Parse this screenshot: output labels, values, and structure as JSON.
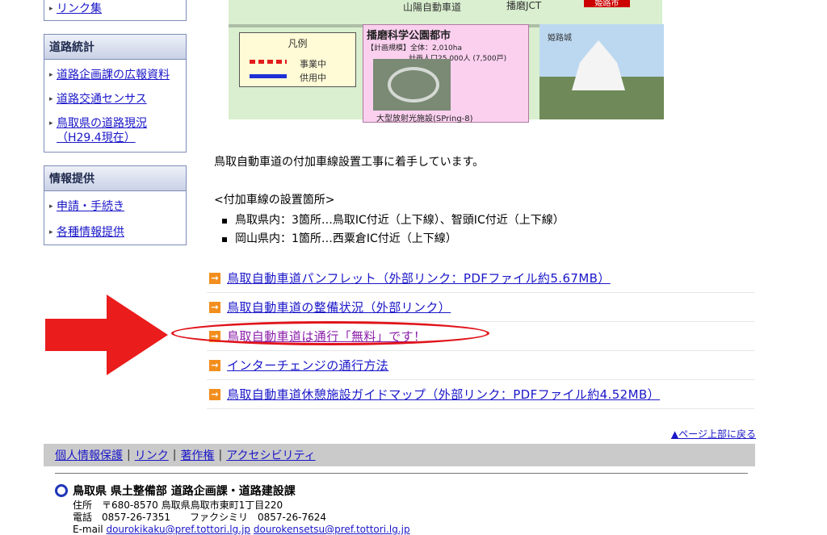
{
  "sidebar": {
    "top_item": "リンク集",
    "boxes": [
      {
        "title": "道路統計",
        "items": [
          "道路企画課の広報資料",
          "道路交通センサス",
          "鳥取県の道路現況",
          "（H29.4現在）"
        ]
      },
      {
        "title": "情報提供",
        "items": [
          "申請・手続き",
          "各種情報提供"
        ]
      }
    ]
  },
  "map": {
    "road_label": "山陽自動車道",
    "jct_label": "播磨JCT",
    "himeji_tag": "姫路市",
    "legend": {
      "title": "凡例",
      "under_construction": "事業中",
      "in_service": "供用中"
    },
    "science_city": {
      "title": "播磨科学公園都市",
      "line1": "【計画規模】全体：2,010ha",
      "line2": "計画人口25,000人 (7,500戸)",
      "caption": "大型放射光施設(SPring-8)"
    },
    "castle_label": "姫路城"
  },
  "intro_text": "鳥取自動車道の付加車線設置工事に着手しています。",
  "sub_title": "<付加車線の設置箇所>",
  "bullets": [
    "鳥取県内：3箇所…鳥取IC付近（上下線）、智頭IC付近（上下線）",
    "岡山県内：1箇所…西粟倉IC付近（上下線）"
  ],
  "links": [
    "鳥取自動車道パンフレット（外部リンク：PDFファイル約5.67MB）",
    "鳥取自動車道の整備状況（外部リンク）",
    "鳥取自動車道は通行「無料」です！",
    "インターチェンジの通行方法",
    "鳥取自動車道休憩施設ガイドマップ（外部リンク：PDFファイル約4.52MB）"
  ],
  "page_top": "▲ページ上部に戻る",
  "footer_links": [
    "個人情報保護",
    "リンク",
    "著作権",
    "アクセシビリティ"
  ],
  "org": "鳥取県 県土整備部 道路企画課・道路建設課",
  "address": {
    "line1": "住所　〒680-8570 鳥取県鳥取市東町1丁目220",
    "line2": "電話　0857-26-7351　　ファクシミリ　0857-26-7624",
    "email_label": "E-mail",
    "email1": "dourokikaku@pref.tottori.lg.jp",
    "email2": "dourokensetsu@pref.tottori.lg.jp"
  },
  "colors": {
    "annotation_red": "#e0141a",
    "link_blue": "#1a16c8",
    "visited_purple": "#8b1fa8",
    "arrow_orange": "#f28e1e"
  }
}
